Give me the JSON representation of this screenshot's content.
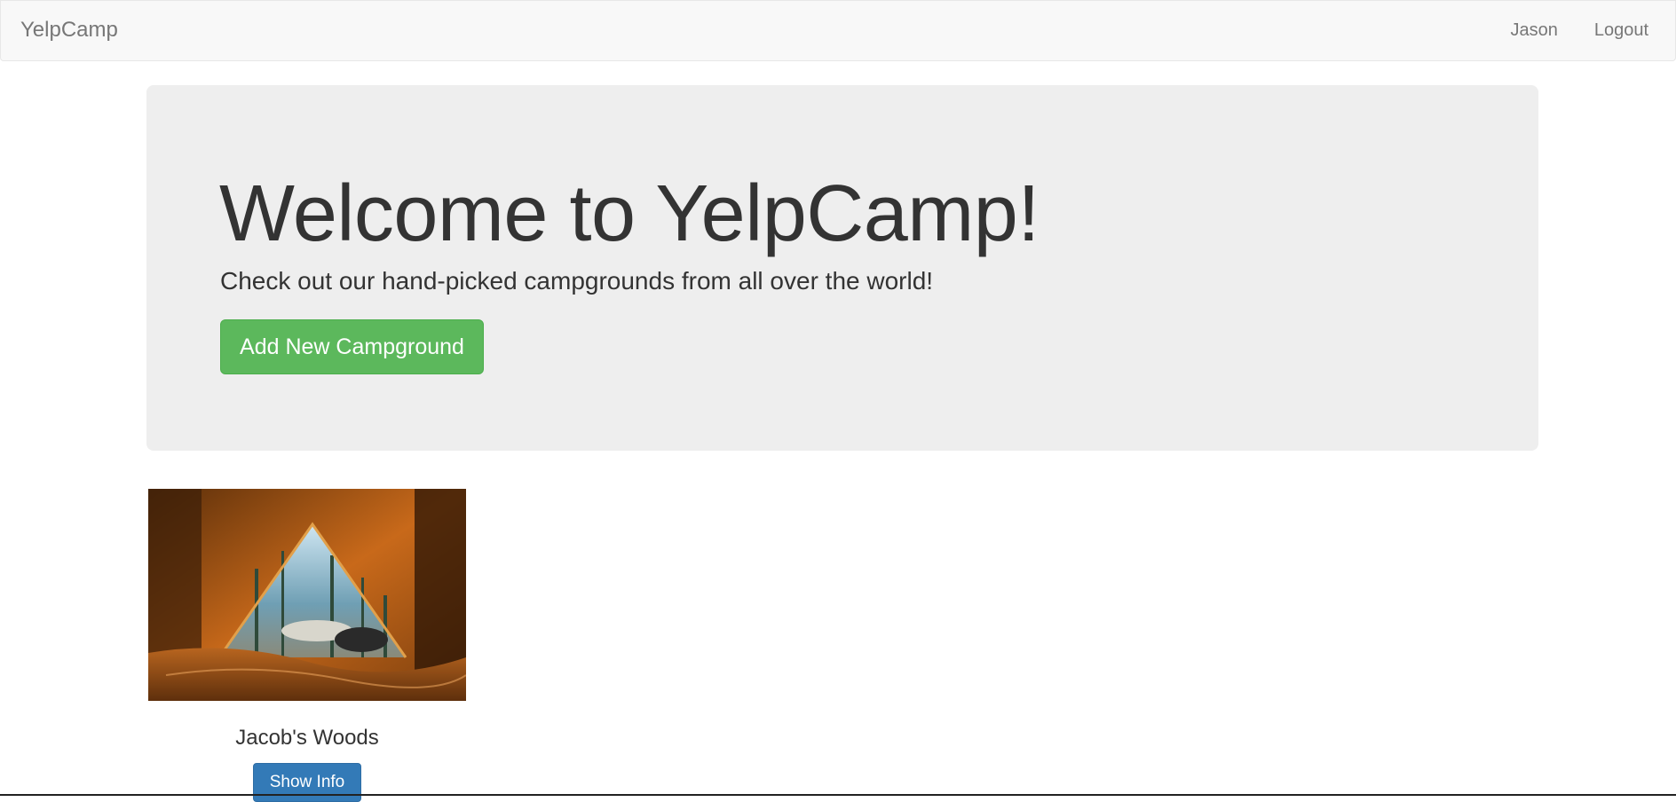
{
  "navbar": {
    "brand": "YelpCamp",
    "links": [
      "Jason",
      "Logout"
    ]
  },
  "jumbotron": {
    "title": "Welcome to YelpCamp!",
    "subtitle": "Check out our hand-picked campgrounds from all over the world!",
    "add_button": "Add New Campground"
  },
  "campgrounds": [
    {
      "name": "Jacob's Woods",
      "button": "Show Info"
    }
  ],
  "colors": {
    "success": "#5cb85c",
    "primary": "#337ab7",
    "jumbotron_bg": "#eeeeee",
    "navbar_bg": "#f8f8f8"
  }
}
